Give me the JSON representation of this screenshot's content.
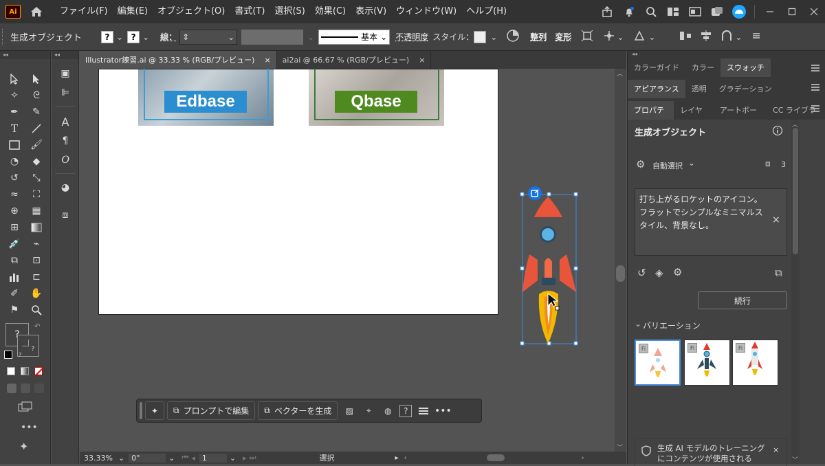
{
  "menubar": {
    "logo": "Ai",
    "menus": [
      "ファイル(F)",
      "編集(E)",
      "オブジェクト(O)",
      "書式(T)",
      "選択(S)",
      "効果(C)",
      "表示(V)",
      "ウィンドウ(W)",
      "ヘルプ(H)"
    ]
  },
  "control_bar": {
    "context_label": "生成オブジェクト",
    "fill_q": "?",
    "stroke_q": "?",
    "stroke_label": "線：",
    "stroke_style": "基本",
    "opacity_label": "不透明度",
    "style_label": "スタイル：",
    "align_label": "整列",
    "transform_label": "変形"
  },
  "tabs": [
    {
      "label": "Illustrator練習.ai @ 33.33 % (RGB/プレビュー)",
      "close": "×"
    },
    {
      "label": "ai2ai @ 66.67 % (RGB/プレビュー)",
      "close": "×"
    }
  ],
  "artboard": {
    "label1": "Edbase",
    "label2": "Qbase",
    "label1_color": "#1f8fd0",
    "label2_color": "#4f8a1e"
  },
  "toolbar": {
    "question": "?"
  },
  "context_task_bar": {
    "edit_prompt": "プロンプトで編集",
    "vectorize": "ベクターを生成",
    "q": "?"
  },
  "status_bar": {
    "zoom": "33.33%",
    "rotation": "0°",
    "page": "1",
    "mode": "選択"
  },
  "panel": {
    "tabs_row1": [
      "カラーガイド",
      "カラー",
      "スウォッチ"
    ],
    "tabs_row2": [
      "アピアランス",
      "透明",
      "グラデーション"
    ],
    "tabs_row3": [
      "プロパティ",
      "レイヤー",
      "アートボード",
      "CC ライブラリ"
    ],
    "title": "生成オブジェクト",
    "auto_select": "自動選択",
    "count": "3",
    "prompt_text": "打ち上がるロケットのアイコン。フラットでシンプルなミニマルスタイル、背景なし。",
    "prompt_close": "×",
    "continue_button": "続行",
    "variations_label": "バリエーション",
    "fi_badge": "Fi",
    "notice": "生成 AI モデルのトレーニングにコンテンツが使用される",
    "notice_close": "×"
  },
  "colors": {
    "accent": "#1473e6",
    "rocket_red": "#e8553b",
    "rocket_blue": "#5ab4e5",
    "flame_yellow": "#f5b800",
    "flame_orange": "#f28c1e"
  }
}
